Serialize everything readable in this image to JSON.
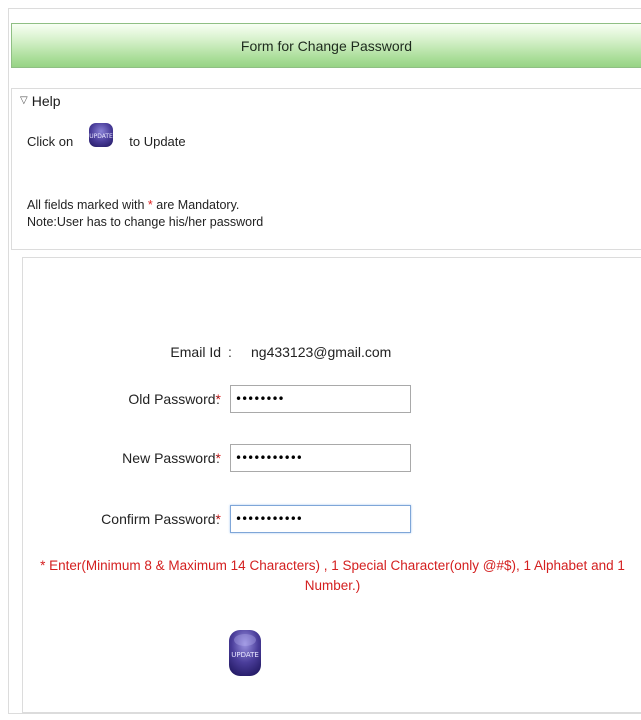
{
  "header": {
    "title": "Form for Change Password"
  },
  "help": {
    "toggle_label": "Help",
    "click_on": "Click on",
    "mini_button_text": "UPDATE",
    "to_update": "to Update",
    "mandatory_prefix": "All fields marked with",
    "mandatory_star": "*",
    "mandatory_suffix": "are Mandatory.",
    "note": "Note:User has to change his/her password"
  },
  "form": {
    "email_label": "Email Id",
    "email_value": "ng433123@gmail.com",
    "old_label": "Old Password",
    "old_value": "12345678",
    "new_label": "New Password",
    "new_value": "12345678901",
    "confirm_label": "Confirm Password",
    "confirm_value": "12345678901",
    "required_star": "*",
    "colon": ":",
    "hint": "* Enter(Minimum 8 & Maximum 14 Characters) , 1 Special Character(only @#$), 1 Alphabet and 1 Number.)",
    "update_button_text": "UPDATE"
  },
  "colors": {
    "header_green": "#a9dd98",
    "required_red": "#e02020",
    "button_purple": "#4a3d9a"
  }
}
